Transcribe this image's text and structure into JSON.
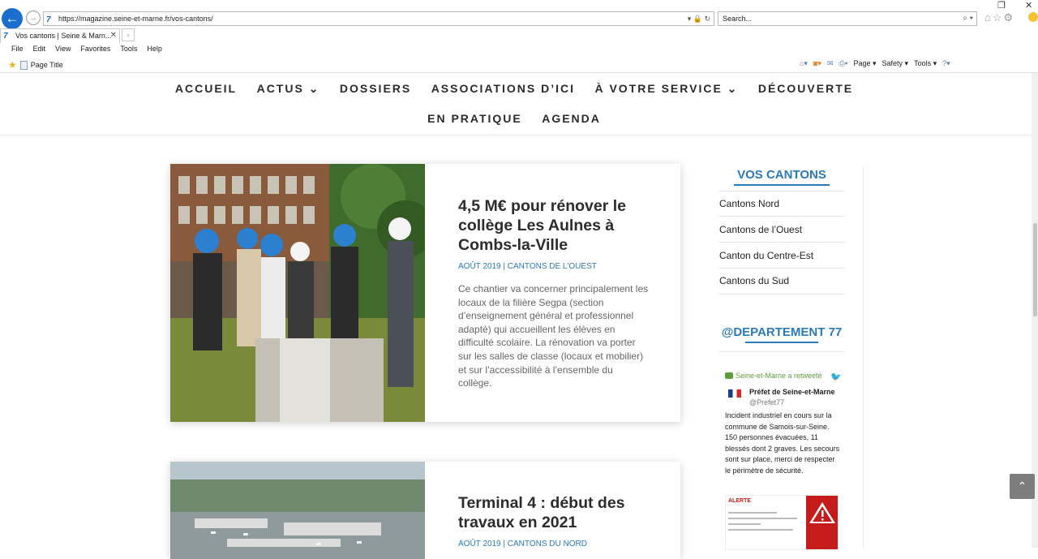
{
  "browser": {
    "url": "https://magazine.seine-et-marne.fr/vos-cantons/",
    "search_placeholder": "Search...",
    "tab_title": "Vos cantons | Seine & Marn...",
    "menu": [
      "File",
      "Edit",
      "View",
      "Favorites",
      "Tools",
      "Help"
    ],
    "favorites_item": "Page Title",
    "command_bar": [
      "Page ▾",
      "Safety ▾",
      "Tools ▾"
    ]
  },
  "nav": {
    "row1": [
      "ACCUEIL",
      "ACTUS ⌄",
      "DOSSIERS",
      "ASSOCIATIONS D’ICI",
      "À VOTRE SERVICE ⌄",
      "DÉCOUVERTE"
    ],
    "row2": [
      "EN PRATIQUE",
      "AGENDA"
    ]
  },
  "articles": [
    {
      "title": "4,5 M€ pour rénover le collège Les Aulnes à Combs-la-Ville",
      "meta": "AOÛT 2019 | CANTONS DE L'OUEST",
      "excerpt": "Ce chantier va concerner principalement les locaux de la filière Segpa (section d’enseignement général et professionnel adapté) qui accueillent les élèves en difficulté scolaire. La rénovation va porter sur les salles de classe (locaux et mobilier) et sur l’accessibilité à l’ensemble du collège."
    },
    {
      "title": "Terminal 4 : début des travaux en 2021",
      "meta": "AOÛT 2019 | CANTONS DU NORD"
    }
  ],
  "sidebar": {
    "heading": "VOS CANTONS",
    "items": [
      "Cantons Nord",
      "Cantons de l’Ouest",
      "Canton du Centre-Est",
      "Cantons du Sud"
    ],
    "twitter_heading": "@DEPARTEMENT 77",
    "tweet": {
      "retweet_label": "Seine-et-Marne a retweeté",
      "author_name": "Préfet de Seine-et-Marne",
      "author_handle": "@Prefet77",
      "text": "Incident industriel en cours  sur la commune de Samois-sur-Seine. 150 personnes évacuées, 11 blessés dont 2 graves. Les secours sont sur place, merci de respecter le périmètre de sécurité.",
      "image_alert": "ALERTE"
    }
  },
  "colors": {
    "accent": "#2a7ab8",
    "nav_text": "#2a2a2a"
  }
}
